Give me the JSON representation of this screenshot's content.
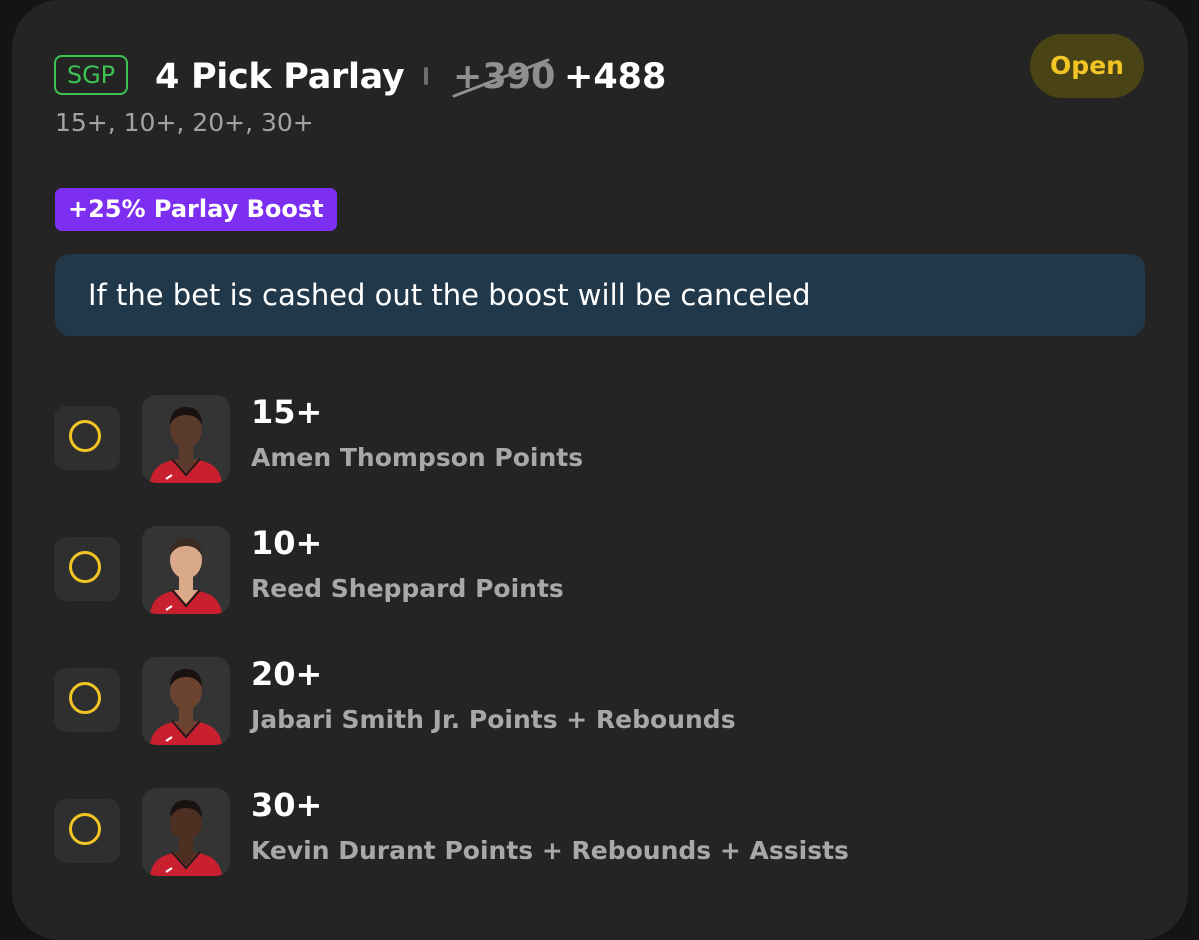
{
  "bet": {
    "tag": "SGP",
    "title": "4 Pick Parlay",
    "original_odds": "+390",
    "boosted_odds": "+488",
    "lines_summary": "15+, 10+, 20+, 30+",
    "status": "Open",
    "boost_label": "+25% Parlay Boost",
    "notice": "If the bet is cashed out the boost will be canceled"
  },
  "legs": [
    {
      "line": "15+",
      "market": "Amen Thompson Points",
      "skin": "#5a3a2a",
      "hair": "#1a1210"
    },
    {
      "line": "10+",
      "market": "Reed Sheppard Points",
      "skin": "#d9a98a",
      "hair": "#3a2a20"
    },
    {
      "line": "20+",
      "market": "Jabari Smith Jr. Points + Rebounds",
      "skin": "#6b4330",
      "hair": "#1a1210"
    },
    {
      "line": "30+",
      "market": "Kevin Durant Points + Rebounds + Assists",
      "skin": "#4e3022",
      "hair": "#1a1210"
    }
  ],
  "colors": {
    "accent_green": "#3ec353",
    "status_yellow": "#f2c524",
    "boost_purple": "#7c2ff0",
    "notice_bg": "#21384a",
    "jersey_red": "#c8202f"
  },
  "icons": {
    "leg_status": "empty-circle-icon",
    "player": "player-headshot"
  }
}
